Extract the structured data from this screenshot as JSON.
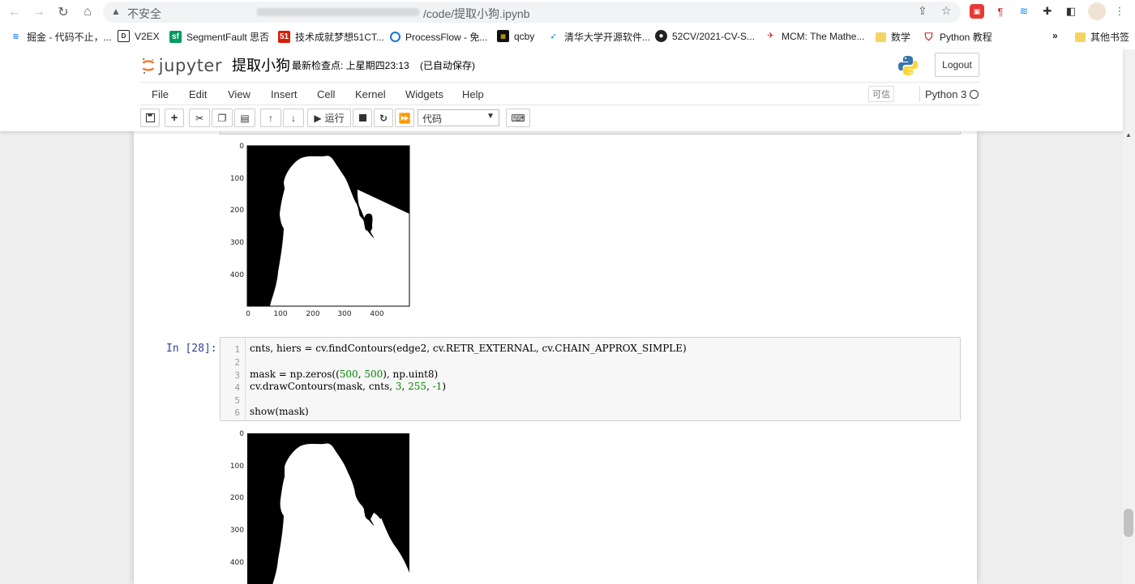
{
  "browser": {
    "security_label": "不安全",
    "url_tail": "/code/提取小狗.ipynb",
    "bookmarks": [
      {
        "label": "掘金 - 代码不止，...",
        "icon": "juejin-icon"
      },
      {
        "label": "V2EX",
        "icon": "v2ex-icon"
      },
      {
        "label": "SegmentFault 思否",
        "icon": "segmentfault-icon"
      },
      {
        "label": "技术成就梦想51CT...",
        "icon": "51cto-icon"
      },
      {
        "label": "ProcessFlow - 免...",
        "icon": "processflow-icon"
      },
      {
        "label": "qcby",
        "icon": "qcby-icon"
      },
      {
        "label": "清华大学开源软件...",
        "icon": "tsinghua-icon"
      },
      {
        "label": "52CV/2021-CV-S...",
        "icon": "github-icon"
      },
      {
        "label": "MCM: The Mathe...",
        "icon": "mcm-icon"
      },
      {
        "label": "数学",
        "icon": "folder-icon"
      },
      {
        "label": "Python 教程",
        "icon": "python-tutorial-icon"
      }
    ],
    "overflow_label": "»",
    "other_bookmarks": "其他书签"
  },
  "jupyter": {
    "logo_text": "jupyter",
    "notebook_name": "提取小狗",
    "checkpoint": "最新检查点: 上星期四23:13",
    "autosave": "(已自动保存)",
    "logout": "Logout",
    "menu": [
      "File",
      "Edit",
      "View",
      "Insert",
      "Cell",
      "Kernel",
      "Widgets",
      "Help"
    ],
    "trusted": "可信",
    "kernel": "Python 3",
    "run_label": "运行",
    "cell_type": "代码"
  },
  "cells": {
    "plot_ticks_y": [
      "0",
      "100",
      "200",
      "300",
      "400"
    ],
    "plot_ticks_x": [
      "0",
      "100",
      "200",
      "300",
      "400"
    ],
    "prompt": "In  [28]:",
    "line_numbers": [
      "1",
      "2",
      "3",
      "4",
      "5",
      "6"
    ]
  },
  "code": {
    "line1": "cnts, hiers = cv.findContours(edge2, cv.RETR_EXTERNAL, cv.CHAIN_APPROX_SIMPLE)",
    "line3_a": "mask = np.zeros((",
    "line3_b": "500",
    "line3_c": ", ",
    "line3_d": "500",
    "line3_e": "), np.uint8)",
    "line4_a": "cv.drawContours(mask, cnts, ",
    "line4_b": "3",
    "line4_c": ", ",
    "line4_d": "255",
    "line4_e": ", ",
    "line4_f": "-1",
    "line4_g": ")",
    "line6": "show(mask)"
  },
  "colors": {
    "prompt_in": "#303f9f",
    "number": "#008800",
    "operator": "#aa22ff",
    "mask_background": "#000000",
    "mask_foreground": "#ffffff"
  }
}
